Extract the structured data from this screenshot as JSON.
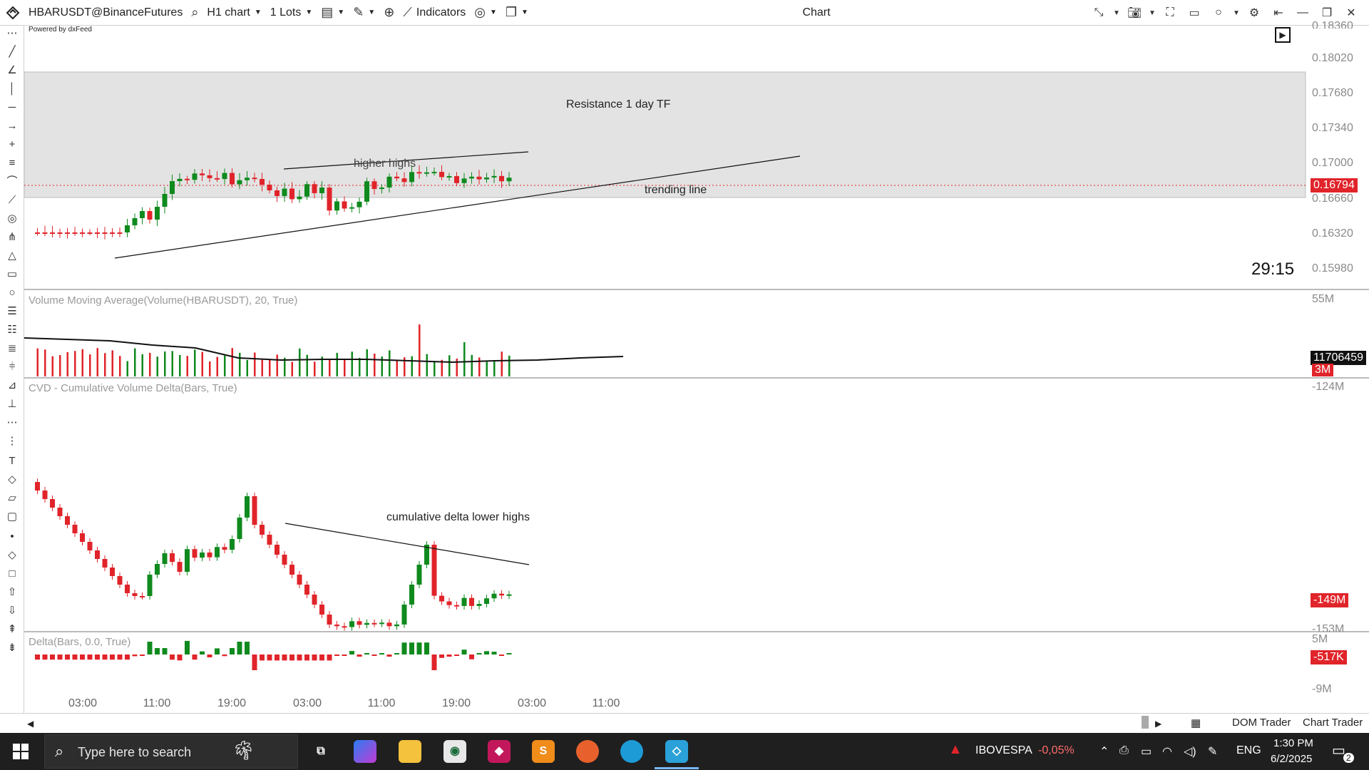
{
  "window": {
    "title": "Chart"
  },
  "toolbar": {
    "symbol": "HBARUSDT@BinanceFutures",
    "timeframe": "H1 chart",
    "lots": "1 Lots",
    "indicators": "Indicators"
  },
  "chart": {
    "powered_by": "Powered by dxFeed",
    "countdown": "29:15",
    "price_axis": [
      "0.18020",
      "0.17680",
      "0.17340",
      "0.17000",
      "0.16660",
      "0.16320",
      "0.15980"
    ],
    "price_axis_top_cut": "0.18360",
    "current_price": "0.16794",
    "time_axis": [
      "03:00",
      "11:00",
      "19:00",
      "03:00",
      "11:00",
      "19:00",
      "03:00",
      "11:00"
    ],
    "annotations": {
      "resistance": "Resistance 1 day TF",
      "higher_highs": "higher highs",
      "trending_line": "trending line",
      "cvd_lower_highs": "cumulative delta lower highs"
    },
    "volume_pane": {
      "title": "Volume Moving Average(Volume(HBARUSDT), 20, True)",
      "axis_top": "55M",
      "value_badge": "11706459",
      "volume_badge": "3M"
    },
    "cvd_pane": {
      "title": "CVD - Cumulative Volume Delta(Bars, True)",
      "axis_top": "-124M",
      "axis_bottom": "-153M",
      "value_badge": "-149M"
    },
    "delta_pane": {
      "title": "Delta(Bars, 0.0, True)",
      "axis_top": "5M",
      "axis_bottom": "-9M",
      "value_badge": "-517K"
    },
    "colors": {
      "up": "#0f8a1e",
      "down": "#e0242a",
      "zone": "#e3e3e3",
      "line": "#111111"
    }
  },
  "bottombar": {
    "dom_trader": "DOM Trader",
    "chart_trader": "Chart Trader"
  },
  "taskbar": {
    "search_placeholder": "Type here to search",
    "ticker_name": "IBOVESPA",
    "ticker_change": "-0,05%",
    "language": "ENG",
    "time": "1:30 PM",
    "date": "6/2/2025",
    "notifications": "2"
  }
}
